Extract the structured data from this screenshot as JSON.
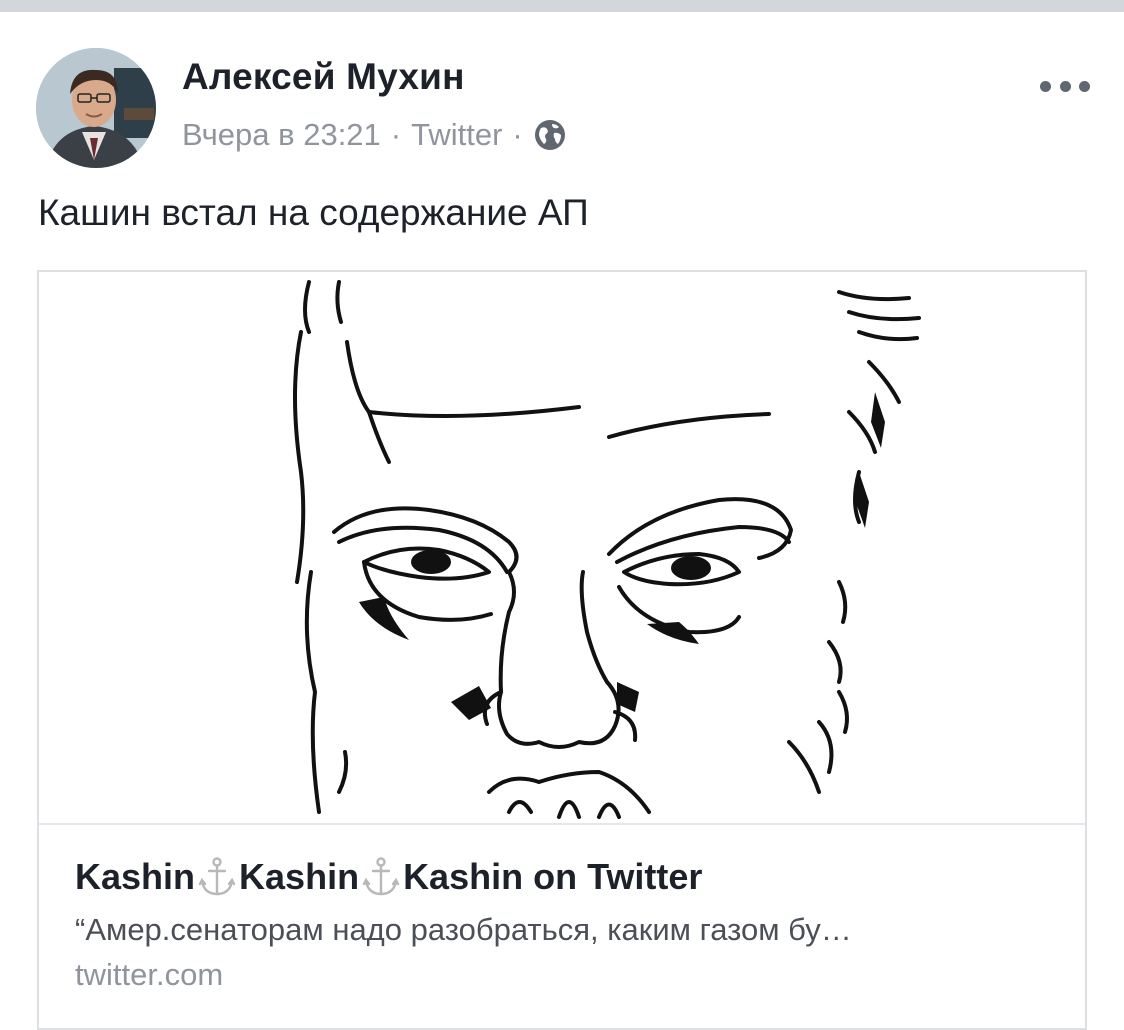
{
  "post": {
    "author_name": "Алексей Мухин",
    "timestamp": "Вчера в 23:21",
    "separator": "·",
    "source": "Twitter",
    "privacy_icon": "globe-icon",
    "more_icon": "more-options-icon",
    "text": "Кашин встал на содержание АП"
  },
  "link_card": {
    "title_parts": [
      "Kashin",
      "Kashin",
      "Kashin on Twitter"
    ],
    "title_icon": "anchor-icon",
    "description": "“Амер.сенаторам надо разобраться, каким газом бу…",
    "domain": "twitter.com"
  }
}
